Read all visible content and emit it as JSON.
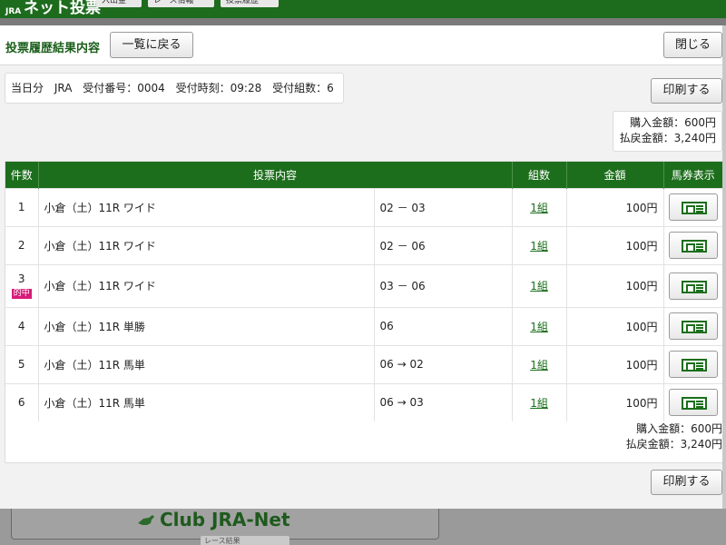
{
  "header": {
    "logo_small": "JRA",
    "logo_title": "ネット投票",
    "nav": [
      "入出金",
      "レース情報",
      "投票履歴"
    ]
  },
  "modal": {
    "title": "投票履歴結果内容",
    "back_label": "一覧に戻る",
    "close_label": "閉じる",
    "print_label": "印刷する"
  },
  "info": {
    "day": "当日分",
    "org": "JRA",
    "receipt_no": "受付番号：0004",
    "receipt_time": "受付時刻：09:28",
    "receipt_count": "受付組数：6"
  },
  "summary": {
    "purchase": "購入金額：600円",
    "payout": "払戻金額：3,240円"
  },
  "table": {
    "headers": [
      "件数",
      "投票内容",
      "組数",
      "金額",
      "馬券表示"
    ],
    "rows": [
      {
        "num": "1",
        "hit": "",
        "race": "小倉（土）11R ワイド",
        "combo": "02 － 03",
        "kumi": "1組",
        "amount": "100円"
      },
      {
        "num": "2",
        "hit": "",
        "race": "小倉（土）11R ワイド",
        "combo": "02 － 06",
        "kumi": "1組",
        "amount": "100円"
      },
      {
        "num": "3",
        "hit": "的中",
        "race": "小倉（土）11R ワイド",
        "combo": "03 － 06",
        "kumi": "1組",
        "amount": "100円"
      },
      {
        "num": "4",
        "hit": "",
        "race": "小倉（土）11R 単勝",
        "combo": "06",
        "kumi": "1組",
        "amount": "100円"
      },
      {
        "num": "5",
        "hit": "",
        "race": "小倉（土）11R 馬単",
        "combo": "06 → 02",
        "kumi": "1組",
        "amount": "100円"
      },
      {
        "num": "6",
        "hit": "",
        "race": "小倉（土）11R 馬単",
        "combo": "06 → 03",
        "kumi": "1組",
        "amount": "100円"
      }
    ]
  },
  "background": {
    "banner": "Club JRA-Net",
    "tab_label": "レース結果"
  },
  "colors": {
    "brand_green": "#1c6e1c",
    "hit_badge": "#d81b78"
  }
}
